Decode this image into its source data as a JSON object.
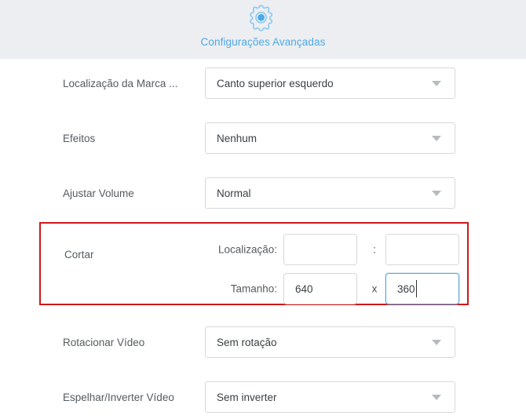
{
  "header": {
    "icon": "gear-icon",
    "title": "Configurações Avançadas",
    "accent_color": "#4fa9e2",
    "background_color": "#eceef2"
  },
  "settings": {
    "rows": [
      {
        "label": "Localização da Marca ...",
        "value": "Canto superior esquerdo"
      },
      {
        "label": "Efeitos",
        "value": "Nenhum"
      },
      {
        "label": "Ajustar Volume",
        "value": "Normal"
      },
      {
        "label": "Rotacionar Vídeo",
        "value": "Sem rotação"
      },
      {
        "label": "Espelhar/Inverter Vídeo",
        "value": "Sem inverter"
      }
    ]
  },
  "crop": {
    "label": "Cortar",
    "highlight_color": "#cc1818",
    "location": {
      "label": "Localização:",
      "x_value": "",
      "x_placeholder": "",
      "separator": ":",
      "y_value": "",
      "y_placeholder": ""
    },
    "size": {
      "label": "Tamanho:",
      "width_value": "640",
      "separator": "x",
      "height_value": "360",
      "focused_field": "height",
      "focus_color": "#5aa9dd"
    }
  }
}
